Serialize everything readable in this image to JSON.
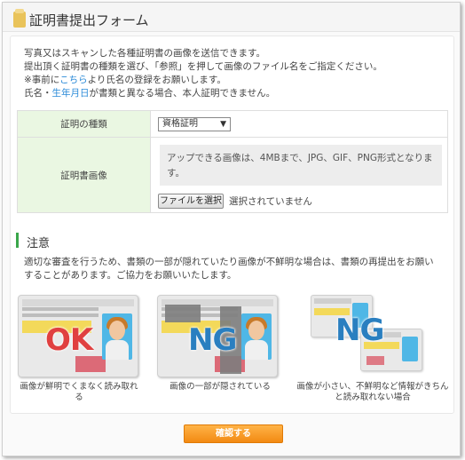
{
  "window": {
    "title": "証明書提出フォーム"
  },
  "intro": {
    "line1": "写真又はスキャンした各種証明書の画像を送信できます。",
    "line2": "提出頂く証明書の種類を選び、「参照」を押して画像のファイル名をご指定ください。",
    "line3_prefix": "※事前に",
    "line3_link": "こちら",
    "line3_suffix": "より氏名の登録をお願いします。",
    "line4_prefix": "氏名・",
    "line4_link": "生年月日",
    "line4_suffix": "が書類と異なる場合、本人証明できません。"
  },
  "form": {
    "type_label": "証明の種類",
    "type_value": "資格証明",
    "type_arrow": "▼",
    "image_label": "証明書画像",
    "upload_note": "アップできる画像は、4MBまで、JPG、GIF、PNG形式となります。",
    "file_button": "ファイルを選択",
    "file_status": "選択されていません"
  },
  "caution": {
    "title": "注意",
    "text": "適切な審査を行うため、書類の一部が隠れていたり画像が不鮮明な場合は、書類の再提出をお願いすることがあります。ご協力をお願いいたします。"
  },
  "examples": [
    {
      "stamp": "OK",
      "caption": "画像が鮮明でくまなく読み取れる"
    },
    {
      "stamp": "NG",
      "caption": "画像の一部が隠されている"
    },
    {
      "stamp": "NG",
      "caption": "画像が小さい、不鮮明など情報がきちんと読み取れない場合"
    }
  ],
  "colors": {
    "ok": "#e04040",
    "ng": "#2a7fc0",
    "accent_green": "#3aa64a",
    "button_orange": "#f28a12"
  },
  "icons": {
    "title": "document-icon",
    "select_arrow": "chevron-down-icon"
  },
  "confirm_button": "確認する"
}
